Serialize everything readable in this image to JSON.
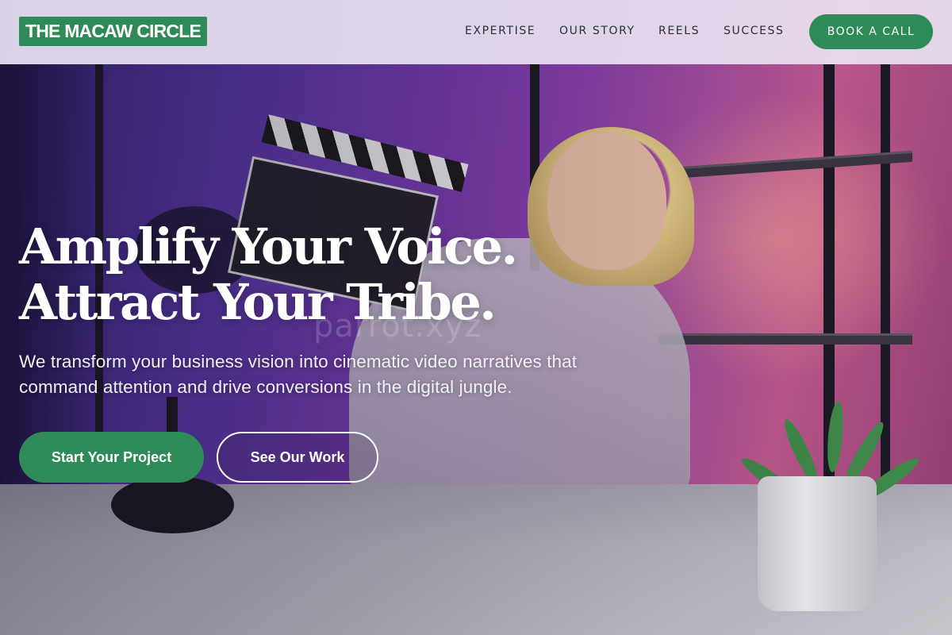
{
  "brand": {
    "logo_text": "THE MACAW CIRCLE",
    "accent": "#2e8b57"
  },
  "nav": {
    "links": [
      "EXPERTISE",
      "OUR STORY",
      "REELS",
      "SUCCESS"
    ],
    "cta_label": "BOOK A CALL"
  },
  "hero": {
    "headline_line1": "Amplify Your Voice.",
    "headline_line2": "Attract Your Tribe.",
    "subtitle": "We transform your business vision into cinematic video narratives that command attention and drive conversions in the digital jungle.",
    "primary_button": "Start Your Project",
    "secondary_button": "See Our Work",
    "watermark": "parrot.xyz"
  }
}
